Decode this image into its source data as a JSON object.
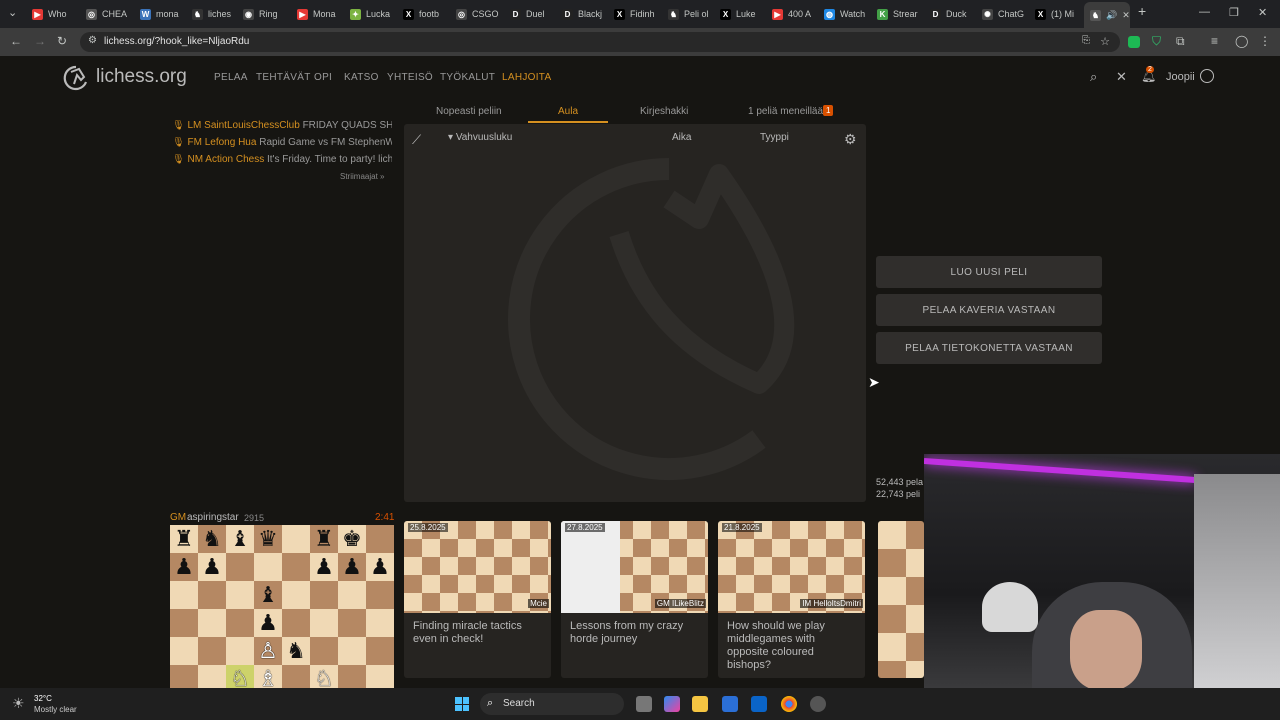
{
  "browser": {
    "tabs": [
      {
        "label": "Who",
        "color": "#e53935",
        "glyph": "▶"
      },
      {
        "label": "CHEA",
        "color": "#555555",
        "glyph": "◎"
      },
      {
        "label": "mona",
        "color": "#3b73b9",
        "glyph": "W"
      },
      {
        "label": "liches",
        "color": "#333333",
        "glyph": "♞"
      },
      {
        "label": "Ring",
        "color": "#444444",
        "glyph": "◉"
      },
      {
        "label": "Mona",
        "color": "#e53935",
        "glyph": "▶"
      },
      {
        "label": "Lucka",
        "color": "#7cb342",
        "glyph": "✦"
      },
      {
        "label": "footb",
        "color": "#000000",
        "glyph": "X"
      },
      {
        "label": "CSGO",
        "color": "#444444",
        "glyph": "◎"
      },
      {
        "label": "Duel",
        "color": "#222222",
        "glyph": "D"
      },
      {
        "label": "Blackj",
        "color": "#222222",
        "glyph": "D"
      },
      {
        "label": "Fidinh",
        "color": "#000000",
        "glyph": "X"
      },
      {
        "label": "Peli ol",
        "color": "#333333",
        "glyph": "♞"
      },
      {
        "label": "Luke",
        "color": "#000000",
        "glyph": "X"
      },
      {
        "label": "400 A",
        "color": "#e53935",
        "glyph": "▶"
      },
      {
        "label": "Watch",
        "color": "#1e88e5",
        "glyph": "◍"
      },
      {
        "label": "Strear",
        "color": "#43a047",
        "glyph": "K"
      },
      {
        "label": "Duck",
        "color": "#222222",
        "glyph": "D"
      },
      {
        "label": "ChatG",
        "color": "#444444",
        "glyph": "✺"
      },
      {
        "label": "(1) Mi",
        "color": "#000000",
        "glyph": "X"
      }
    ],
    "active_tab_icon": "lichess-icon",
    "url": "lichess.org/?hook_like=NljaoRdu",
    "new_tab": "+"
  },
  "site": {
    "logo_text": "lichess.org",
    "nav": [
      "PELAA",
      "TEHTÄVÄT",
      "OPI",
      "KATSO",
      "YHTEISÖ",
      "TYÖKALUT",
      "LAHJOITA"
    ],
    "notification_count": "2",
    "username": "Joopii"
  },
  "lobby_tabs": [
    {
      "label": "Nopeasti peliin",
      "active": false
    },
    {
      "label": "Aula",
      "active": true
    },
    {
      "label": "Kirjeshakki",
      "active": false
    },
    {
      "label": "1 peliä meneillään",
      "active": false,
      "badge": "1"
    }
  ],
  "streamers": [
    {
      "title": "LM",
      "name": "SaintLouisChessClub",
      "desc": "FRIDAY QUADS SHOW!..."
    },
    {
      "title": "FM",
      "name": "Lefong Hua",
      "desc": "Rapid Game vs FM StephenWilly ..."
    },
    {
      "title": "NM",
      "name": "Action Chess",
      "desc": "It's Friday. Time to party! liches..."
    }
  ],
  "streamers_more": "Striimaajat »",
  "lobby": {
    "col_rating": "Vahvuusluku",
    "col_time": "Aika",
    "col_type": "Tyyppi"
  },
  "buttons": [
    "LUO UUSI PELI",
    "PELAA KAVERIA VASTAAN",
    "PELAA TIETOKONETTA VASTAAN"
  ],
  "counts": [
    "52,443 pela",
    "22,743 peli"
  ],
  "tv": {
    "title": "GM",
    "player": "aspiringstar",
    "rating": "2915",
    "clock": "2:41"
  },
  "cards": [
    {
      "date": "25.8.2025",
      "author": "Mcie",
      "title": "Finding miracle tactics even in check!"
    },
    {
      "date": "27.8.2025",
      "author": "GM ILikeBlitz",
      "title": "Lessons from my crazy horde journey"
    },
    {
      "date": "21.8.2025",
      "author": "IM HelloItsDmitri",
      "title": "How should we play middlegames with opposite coloured bishops?"
    }
  ],
  "weather": {
    "temp": "32°C",
    "desc": "Mostly clear"
  },
  "taskbar": {
    "search": "Search"
  },
  "colors": {
    "accent": "#d59020",
    "background": "#161512",
    "panel": "#262421"
  }
}
